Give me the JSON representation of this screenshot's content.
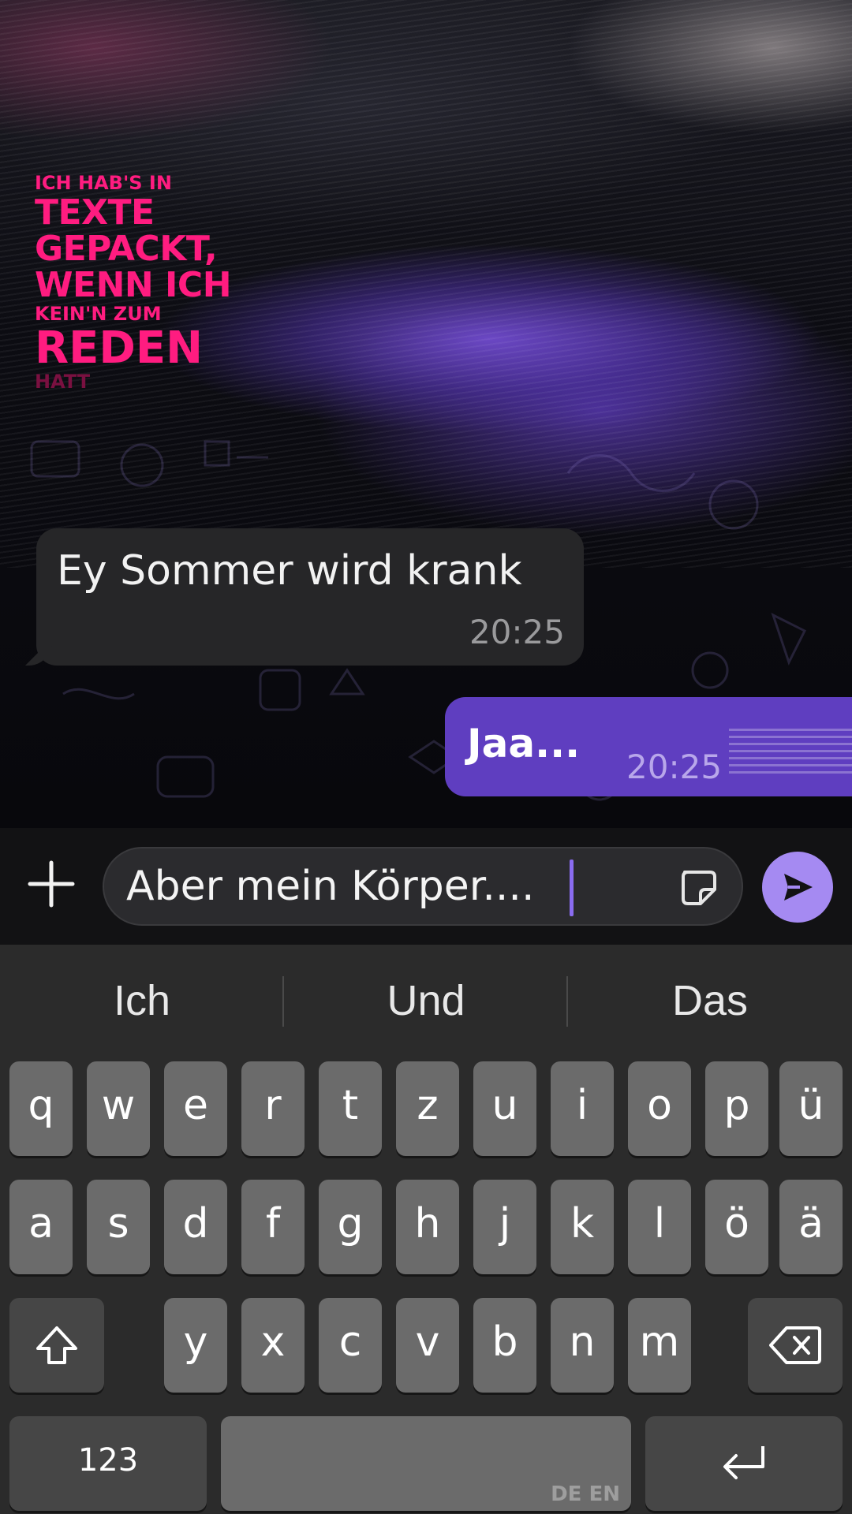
{
  "wallpaper": {
    "poster_lines": [
      "ICH HAB'S IN",
      "TEXTE",
      "GEPACKT,",
      "WENN ICH",
      "KEIN'N ZUM",
      "REDEN",
      "HATT"
    ],
    "poster_color": "#ff1c80"
  },
  "messages": [
    {
      "direction": "incoming",
      "text": "Ey Sommer wird krank",
      "time": "20:25"
    },
    {
      "direction": "outgoing",
      "text": "Jaa...",
      "time": "20:25"
    }
  ],
  "composer": {
    "value": "Aber mein Körper....",
    "send_color": "#a58af2"
  },
  "keyboard": {
    "suggestions": [
      "Ich",
      "Und",
      "Das"
    ],
    "row1": [
      "q",
      "w",
      "e",
      "r",
      "t",
      "z",
      "u",
      "i",
      "o",
      "p",
      "ü"
    ],
    "row2": [
      "a",
      "s",
      "d",
      "f",
      "g",
      "h",
      "j",
      "k",
      "l",
      "ö",
      "ä"
    ],
    "row3": [
      "y",
      "x",
      "c",
      "v",
      "b",
      "n",
      "m"
    ],
    "numbers_key": "123",
    "space_hint": "DE EN"
  },
  "colors": {
    "outgoing_bubble": "#5f3ec0",
    "incoming_bubble": "#262628",
    "keyboard_bg": "#2b2b2b"
  }
}
